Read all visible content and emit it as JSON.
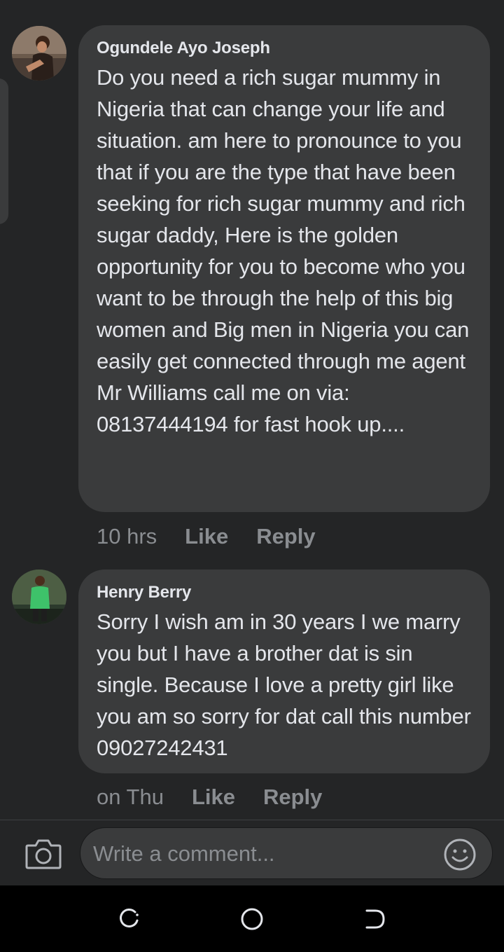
{
  "comments": [
    {
      "author": "Ogundele Ayo Joseph",
      "text": "Do you need a rich sugar mummy in Nigeria that can change your life and situation. am here to pronounce to you that if you are the type that have been seeking for rich sugar mummy and rich sugar daddy, Here is the golden opportunity for you to become who you want to be through the help of this big women and Big men in Nigeria you can easily get connected through me agent Mr Williams call me on via: 08137444194 for fast hook up....",
      "time": "10 hrs",
      "like_label": "Like",
      "reply_label": "Reply"
    },
    {
      "author": "Henry Berry",
      "text": "Sorry I wish am in 30 years I we marry you but I have a brother dat is sin single. Because I love a pretty girl like you am so sorry for dat call this number 09027242431",
      "time": "on Thu",
      "like_label": "Like",
      "reply_label": "Reply"
    }
  ],
  "composer": {
    "placeholder": "Write a comment...",
    "camera_icon": "camera-icon",
    "emoji_icon": "emoji-icon"
  },
  "navbar": {
    "icons": [
      "recent-apps-icon",
      "home-icon",
      "back-icon"
    ]
  },
  "colors": {
    "background": "#242526",
    "bubble": "#3a3b3c",
    "text": "#e4e6eb",
    "secondary_text": "#8a8d91"
  }
}
